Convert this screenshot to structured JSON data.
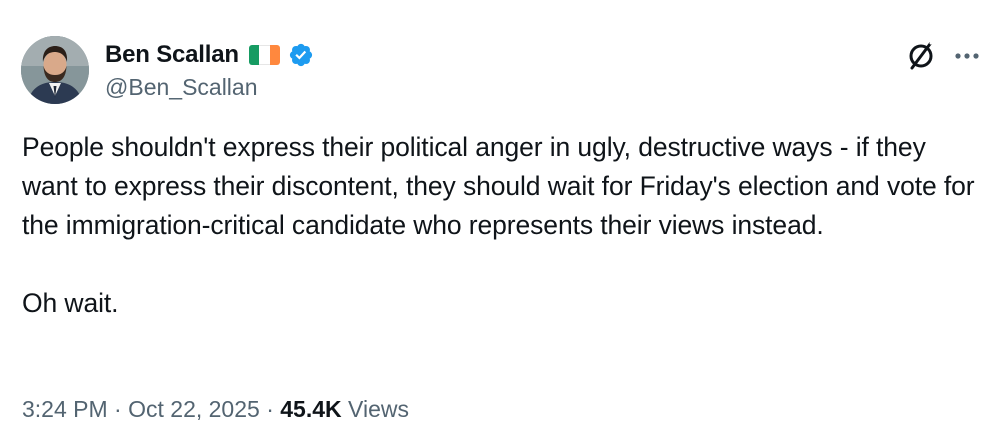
{
  "author": {
    "display_name": "Ben Scallan",
    "handle": "@Ben_Scallan",
    "flag": {
      "colors": [
        "#169b62",
        "#ffffff",
        "#ff883e"
      ]
    },
    "verified": true,
    "verified_color": "#1d9bf0",
    "avatar_icon": "profile-photo"
  },
  "actions": {
    "grok_icon": "grok-icon",
    "more_icon": "more-icon"
  },
  "tweet": {
    "paragraphs": [
      "People shouldn't express their political anger in ugly, destructive ways - if they want to express their discontent, they should wait for Friday's election and vote for the immigration-critical candidate who represents their views instead.",
      "Oh wait."
    ]
  },
  "meta": {
    "time": "3:24 PM",
    "separator": "·",
    "date": "Oct 22, 2025",
    "views_count": "45.4K",
    "views_label": "Views"
  }
}
